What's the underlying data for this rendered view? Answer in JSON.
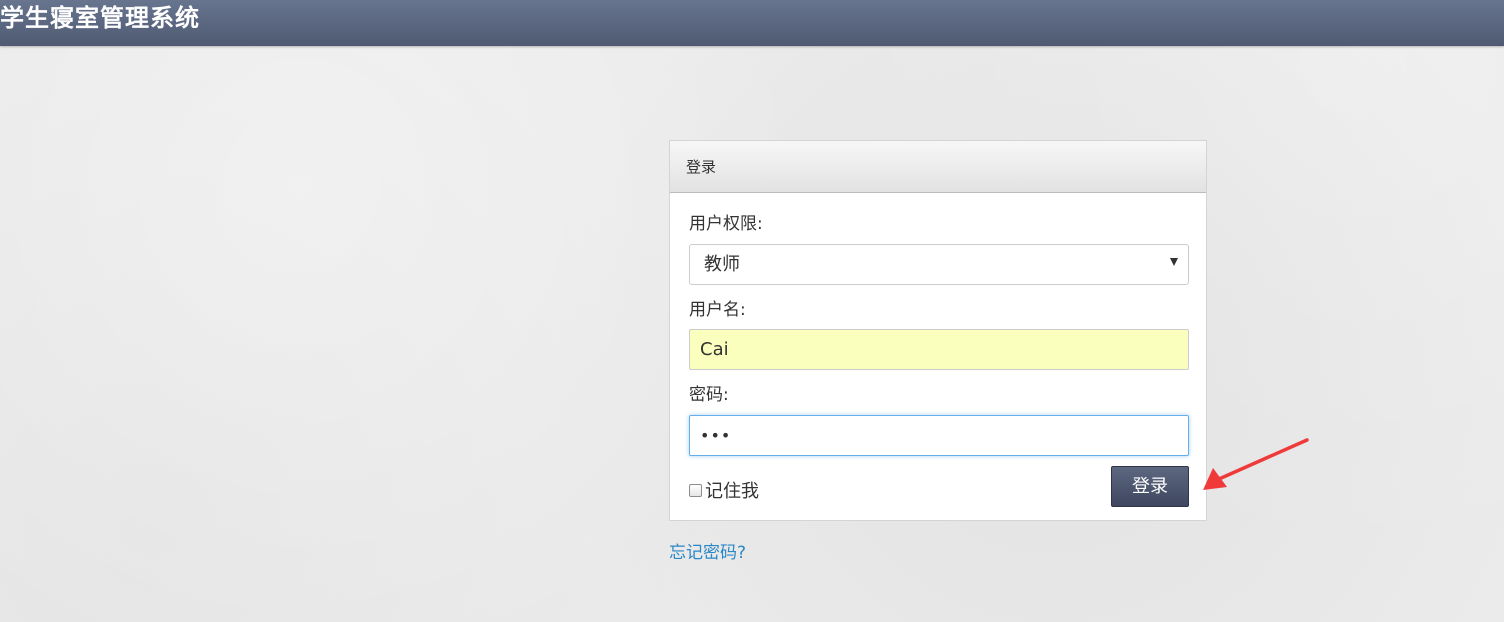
{
  "app": {
    "title": "学生寝室管理系统"
  },
  "login": {
    "header": "登录",
    "role_label": "用户权限:",
    "role_value": "教师",
    "username_label": "用户名:",
    "username_value": "Cai",
    "password_label": "密码:",
    "password_value": "•••",
    "remember_label": "记住我",
    "submit_label": "登录",
    "forgot_label": "忘记密码?"
  },
  "icons": {
    "select_caret": "caret-down-icon",
    "annotation": "red-arrow-icon"
  },
  "colors": {
    "topbar": "#5b6680",
    "button": "#4a5268",
    "link": "#2a87c8",
    "autofill": "#fbffbd",
    "focus": "#66afe9",
    "annotation": "#f03a3a"
  }
}
